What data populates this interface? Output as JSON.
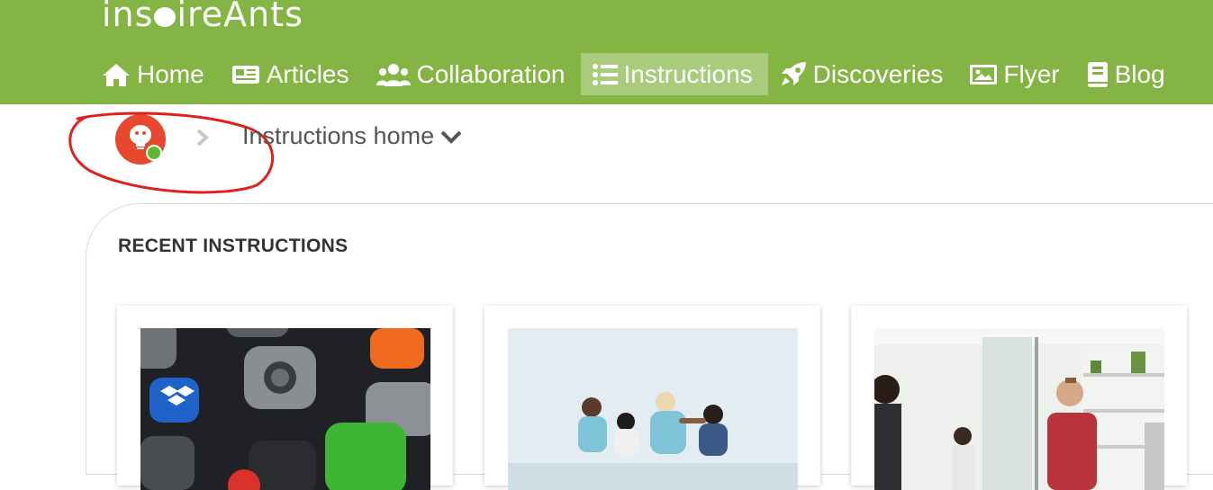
{
  "brand": {
    "logo_text_left": "ins",
    "logo_text_right": "ireAnts"
  },
  "nav": {
    "items": [
      {
        "label": "Home",
        "icon": "home-icon"
      },
      {
        "label": "Articles",
        "icon": "newspaper-icon"
      },
      {
        "label": "Collaboration",
        "icon": "users-icon"
      },
      {
        "label": "Instructions",
        "icon": "list-icon",
        "active": true
      },
      {
        "label": "Discoveries",
        "icon": "rocket-icon"
      },
      {
        "label": "Flyer",
        "icon": "image-icon"
      },
      {
        "label": "Blog",
        "icon": "book-icon"
      }
    ]
  },
  "breadcrumb": {
    "current": "Instructions home"
  },
  "recent": {
    "title": "RECENT INSTRUCTIONS",
    "cards": [
      {
        "image": "phone-apps-photo"
      },
      {
        "image": "group-beach-photo"
      },
      {
        "image": "office-meeting-photo"
      }
    ]
  },
  "colors": {
    "header_green": "#84b544",
    "avatar_red": "#e8492e",
    "online_green": "#5cb82e",
    "annotation_red": "#e0201c"
  }
}
